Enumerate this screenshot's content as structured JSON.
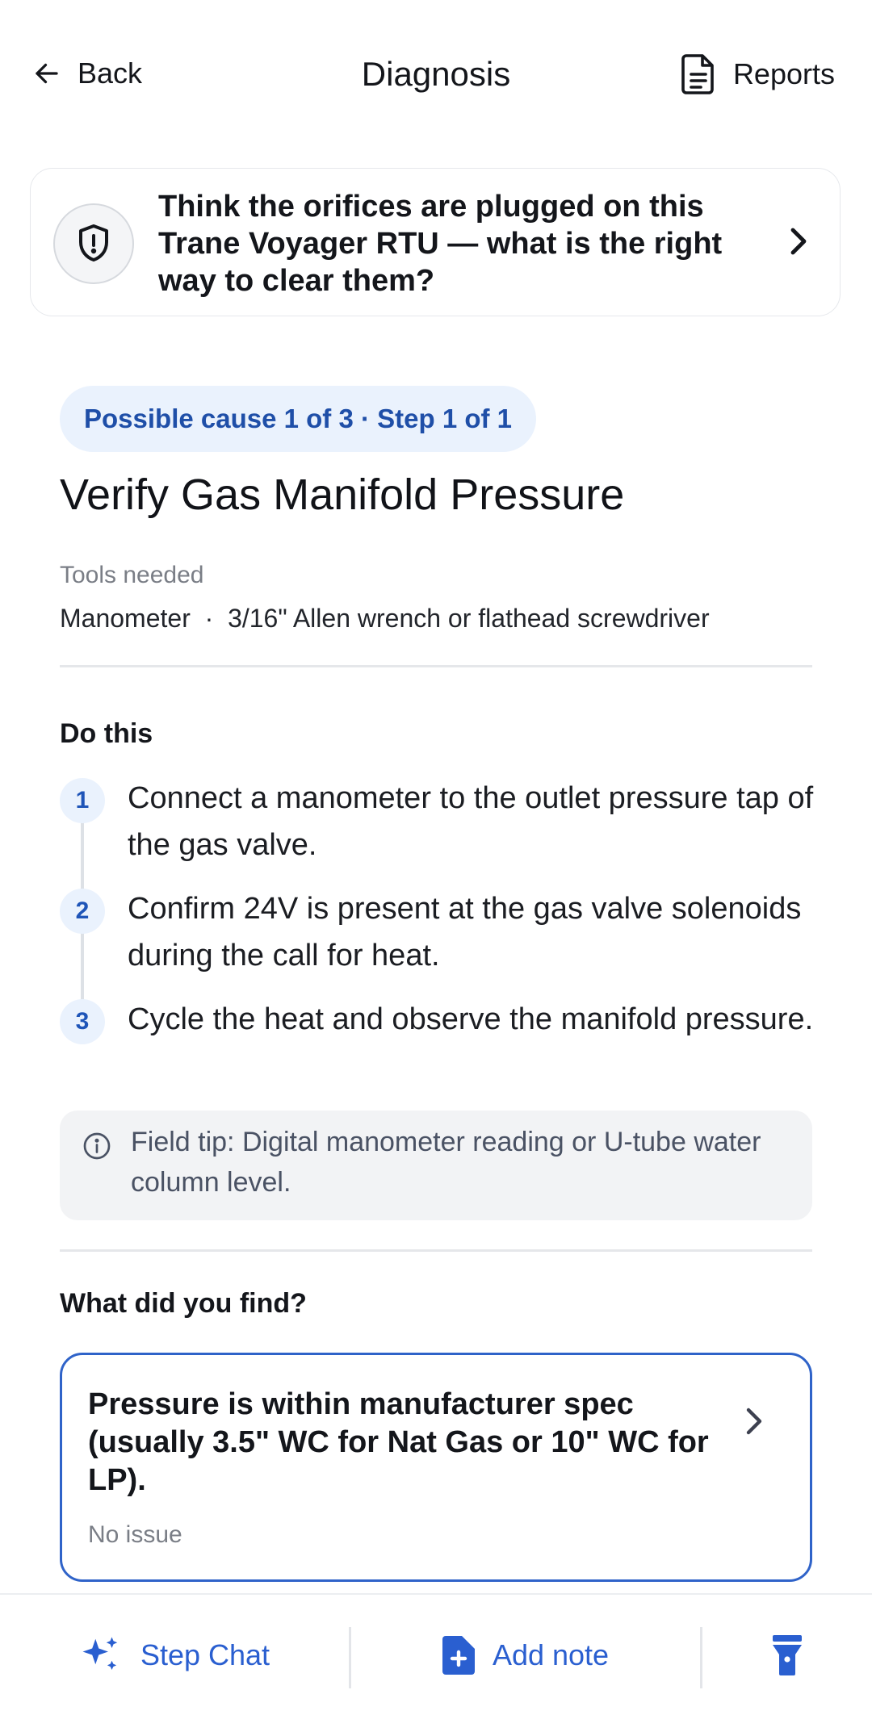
{
  "header": {
    "back_label": "Back",
    "title": "Diagnosis",
    "reports_label": "Reports"
  },
  "question": {
    "text": "Think the orifices are plugged on this Trane Voyager RTU — what is the right way to clear them?"
  },
  "step": {
    "progress": "Possible cause 1 of 3 · Step 1 of 1",
    "title": "Verify Gas Manifold Pressure",
    "tools_label": "Tools needed",
    "tools": "Manometer  ·  3/16\" Allen wrench or flathead screwdriver",
    "do_this_label": "Do this",
    "instructions": [
      {
        "num": "1",
        "text": "Connect a manometer to the outlet pressure tap of the gas valve."
      },
      {
        "num": "2",
        "text": "Confirm 24V is present at the gas valve solenoids during the call for heat."
      },
      {
        "num": "3",
        "text": "Cycle the heat and observe the manifold pressure."
      }
    ],
    "tip": "Field tip: Digital manometer reading or U-tube water column level."
  },
  "findings": {
    "label": "What did you find?",
    "options": [
      {
        "text": "Pressure is within manufacturer spec (usually 3.5\" WC for Nat Gas or 10\" WC for LP).",
        "sub": "No issue"
      }
    ]
  },
  "bottom_bar": {
    "step_chat_label": "Step Chat",
    "add_note_label": "Add note"
  },
  "colors": {
    "accent": "#2a5fd0",
    "pill_bg": "#eaf2fd",
    "tip_bg": "#f2f3f5"
  }
}
